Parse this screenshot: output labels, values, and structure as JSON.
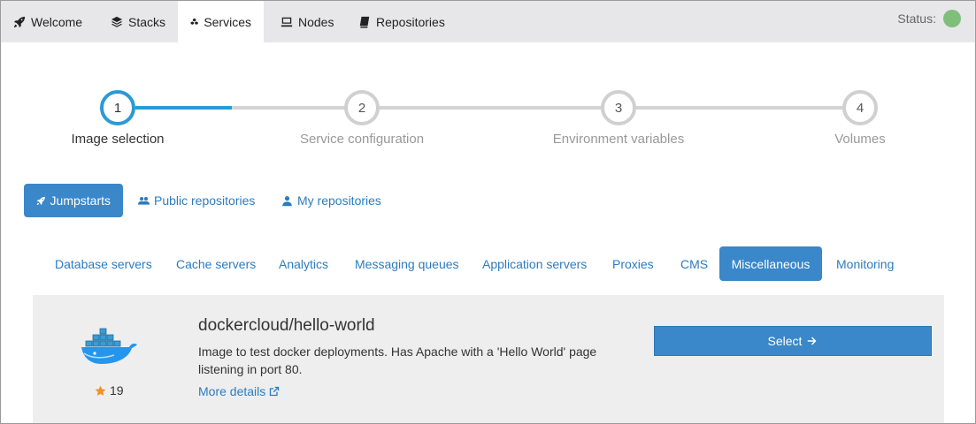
{
  "nav": {
    "tabs": [
      {
        "label": "Welcome",
        "icon": "rocket-icon"
      },
      {
        "label": "Stacks",
        "icon": "layers-icon"
      },
      {
        "label": "Services",
        "icon": "cubes-icon",
        "active": true
      },
      {
        "label": "Nodes",
        "icon": "server-icon"
      },
      {
        "label": "Repositories",
        "icon": "book-icon"
      }
    ],
    "status_label": "Status:",
    "status_color": "#7fbf7b"
  },
  "stepper": {
    "steps": [
      {
        "number": "1",
        "label": "Image selection",
        "active": true
      },
      {
        "number": "2",
        "label": "Service configuration"
      },
      {
        "number": "3",
        "label": "Environment variables"
      },
      {
        "number": "4",
        "label": "Volumes"
      }
    ],
    "progress_fraction": 0.35
  },
  "sources": [
    {
      "label": "Jumpstarts",
      "icon": "rocket-icon",
      "active": true
    },
    {
      "label": "Public repositories",
      "icon": "users-icon"
    },
    {
      "label": "My repositories",
      "icon": "user-icon"
    }
  ],
  "categories": [
    "Database servers",
    "Cache servers",
    "Analytics",
    "Messaging queues",
    "Application servers",
    "Proxies",
    "CMS",
    "Miscellaneous",
    "Monitoring"
  ],
  "active_category": "Miscellaneous",
  "image": {
    "name": "dockercloud/hello-world",
    "description": "Image to test docker deployments. Has Apache with a 'Hello World' page listening in port 80.",
    "stars": "19",
    "more_details": "More details",
    "select_label": "Select",
    "logo": "docker-whale-logo"
  },
  "colors": {
    "accent": "#3a87c9",
    "link": "#2b7cc1",
    "step_active": "#2b9ad6"
  }
}
